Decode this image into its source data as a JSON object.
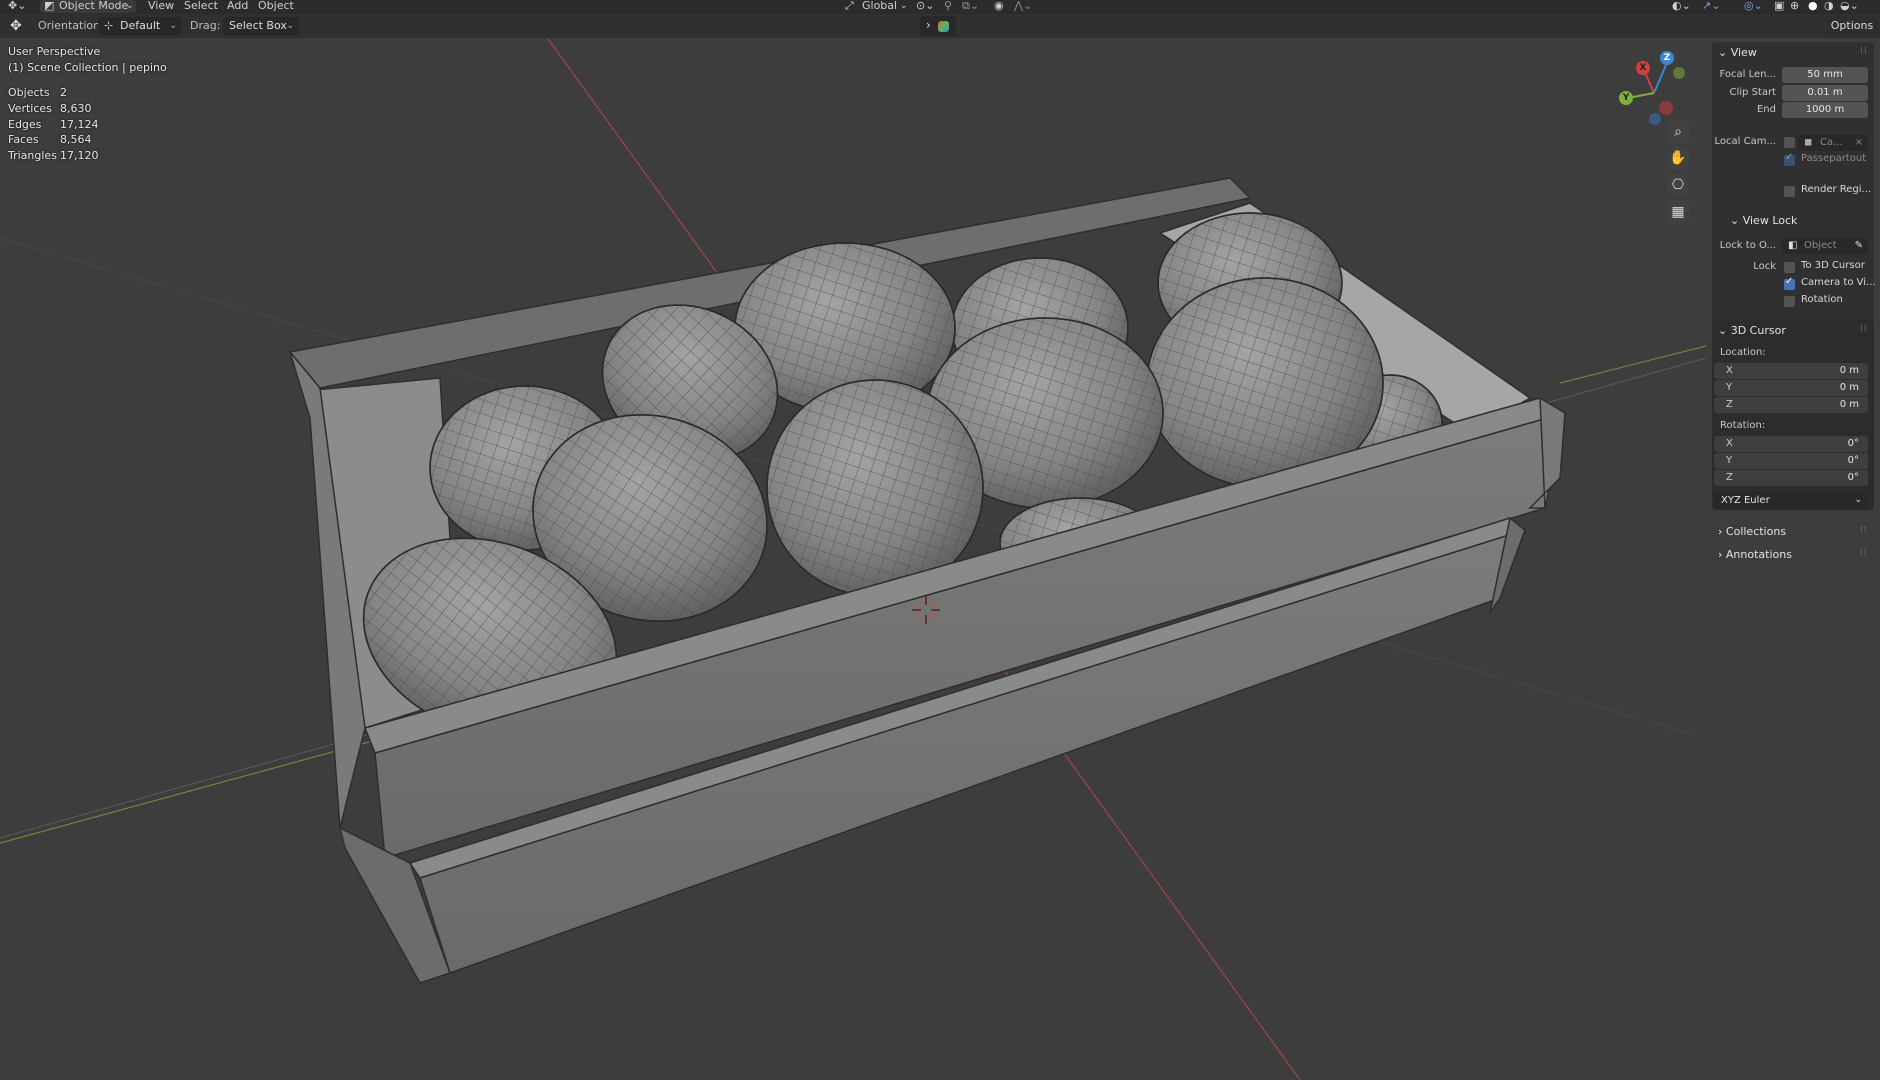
{
  "header": {
    "mode": "Object Mode",
    "menus": [
      "View",
      "Select",
      "Add",
      "Object"
    ],
    "transform_orientation": "Global"
  },
  "toolbar": {
    "orientation_label": "Orientation:",
    "orientation_value": "Default",
    "drag_label": "Drag:",
    "drag_value": "Select Box"
  },
  "viewport": {
    "perspective": "User Perspective",
    "collection_info": "(1) Scene Collection | pepino",
    "stats": [
      {
        "label": "Objects",
        "value": "2"
      },
      {
        "label": "Vertices",
        "value": "8,630"
      },
      {
        "label": "Edges",
        "value": "17,124"
      },
      {
        "label": "Faces",
        "value": "8,564"
      },
      {
        "label": "Triangles",
        "value": "17,120"
      }
    ],
    "gizmo_axes": {
      "x": "X",
      "y": "Y",
      "z": "Z"
    }
  },
  "sidebar": {
    "options": "Options",
    "view": {
      "title": "View",
      "focal_length_label": "Focal Len...",
      "focal_length": "50 mm",
      "clip_start_label": "Clip Start",
      "clip_start": "0.01 m",
      "end_label": "End",
      "end": "1000 m",
      "local_camera_label": "Local Cam...",
      "local_camera_value": "Ca...",
      "passepartout": "Passepartout",
      "render_region": "Render Regi..."
    },
    "view_lock": {
      "title": "View Lock",
      "lock_to_label": "Lock to O...",
      "lock_to_placeholder": "Object",
      "lock_label": "Lock",
      "to_3d_cursor": "To 3D Cursor",
      "camera_to_view": "Camera to Vi...",
      "rotation": "Rotation"
    },
    "cursor": {
      "title": "3D Cursor",
      "location_label": "Location:",
      "location": [
        {
          "axis": "X",
          "value": "0 m"
        },
        {
          "axis": "Y",
          "value": "0 m"
        },
        {
          "axis": "Z",
          "value": "0 m"
        }
      ],
      "rotation_label": "Rotation:",
      "rotation": [
        {
          "axis": "X",
          "value": "0°"
        },
        {
          "axis": "Y",
          "value": "0°"
        },
        {
          "axis": "Z",
          "value": "0°"
        }
      ],
      "rotation_mode": "XYZ Euler"
    },
    "collections": "Collections",
    "annotations": "Annotations"
  },
  "colors": {
    "background": "#3d3d3d",
    "x_axis": "#d0403f",
    "y_axis": "#7fb03c",
    "z_axis": "#3c87d6",
    "checkbox_on": "#4772b3"
  }
}
